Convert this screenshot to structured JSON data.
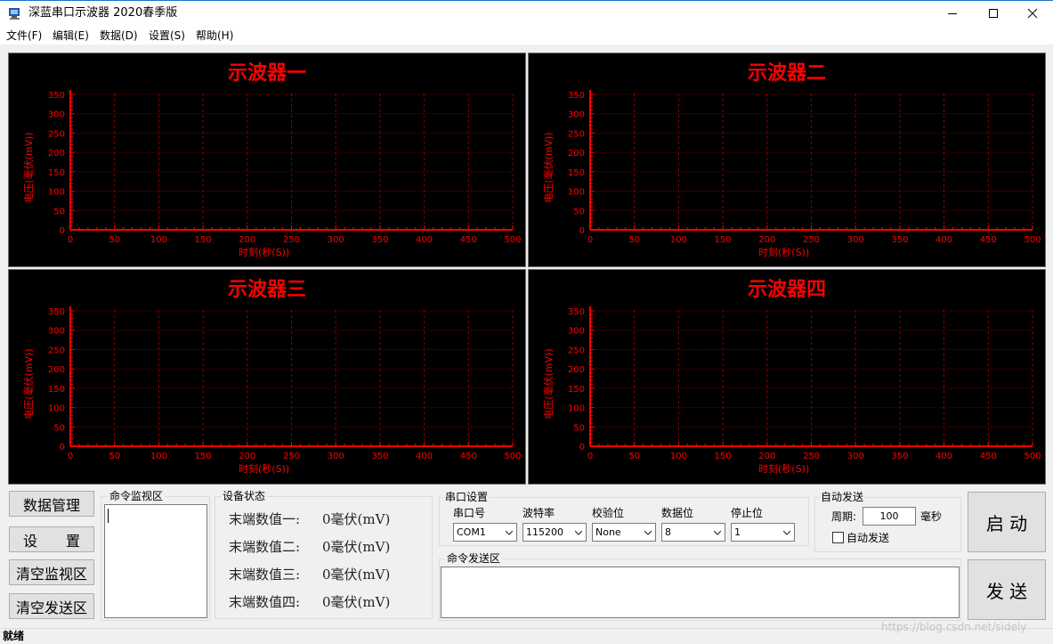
{
  "window": {
    "title": "深蓝串口示波器 2020春季版"
  },
  "menu": [
    "文件(F)",
    "编辑(E)",
    "数据(D)",
    "设置(S)",
    "帮助(H)"
  ],
  "scope": {
    "x_label": "时刻(秒(S))",
    "y_label": "电压(毫伏(mV))",
    "x_ticks": [
      "0",
      "50",
      "100",
      "150",
      "200",
      "250",
      "300",
      "350",
      "400",
      "450",
      "500"
    ],
    "y_ticks": [
      "0",
      "50",
      "100",
      "150",
      "200",
      "250",
      "300",
      "350"
    ],
    "titles": [
      "示波器一",
      "示波器二",
      "示波器三",
      "示波器四"
    ],
    "color": "#ff0000",
    "grid_color": "#8b0000"
  },
  "chart_data": [
    {
      "type": "line",
      "title": "示波器一",
      "xlabel": "时刻(秒(S))",
      "ylabel": "电压(毫伏(mV))",
      "xlim": [
        0,
        500
      ],
      "ylim": [
        0,
        350
      ],
      "series": [],
      "grid": true
    },
    {
      "type": "line",
      "title": "示波器二",
      "xlabel": "时刻(秒(S))",
      "ylabel": "电压(毫伏(mV))",
      "xlim": [
        0,
        500
      ],
      "ylim": [
        0,
        350
      ],
      "series": [],
      "grid": true
    },
    {
      "type": "line",
      "title": "示波器三",
      "xlabel": "时刻(秒(S))",
      "ylabel": "电压(毫伏(mV))",
      "xlim": [
        0,
        500
      ],
      "ylim": [
        0,
        350
      ],
      "series": [],
      "grid": true
    },
    {
      "type": "line",
      "title": "示波器四",
      "xlabel": "时刻(秒(S))",
      "ylabel": "电压(毫伏(mV))",
      "xlim": [
        0,
        500
      ],
      "ylim": [
        0,
        350
      ],
      "series": [],
      "grid": true
    }
  ],
  "buttons": {
    "data_manage": "数据管理",
    "settings": "设　　置",
    "clear_monitor": "清空监视区",
    "clear_send": "清空发送区",
    "start": "启 动",
    "send": "发 送"
  },
  "monitor": {
    "title": "命令监视区"
  },
  "device_status": {
    "title": "设备状态",
    "rows": [
      {
        "label": "末端数值一:",
        "value": "0毫伏(mV)"
      },
      {
        "label": "末端数值二:",
        "value": "0毫伏(mV)"
      },
      {
        "label": "末端数值三:",
        "value": "0毫伏(mV)"
      },
      {
        "label": "末端数值四:",
        "value": "0毫伏(mV)"
      }
    ]
  },
  "serial": {
    "title": "串口设置",
    "fields": [
      {
        "label": "串口号",
        "value": "COM1"
      },
      {
        "label": "波特率",
        "value": "115200"
      },
      {
        "label": "校验位",
        "value": "None"
      },
      {
        "label": "数据位",
        "value": "8"
      },
      {
        "label": "停止位",
        "value": "1"
      }
    ]
  },
  "command_send": {
    "title": "命令发送区"
  },
  "auto_send": {
    "title": "自动发送",
    "period_label": "周期:",
    "period_value": "100",
    "unit": "毫秒",
    "checkbox_label": "自动发送",
    "checked": false
  },
  "status_bar": {
    "text": "就绪"
  },
  "watermark": "https://blog.csdn.net/sidely"
}
